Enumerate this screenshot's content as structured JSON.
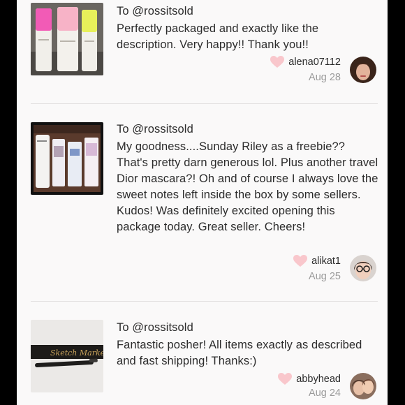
{
  "reviews": [
    {
      "recipient": "To @rossitsold",
      "body": "Perfectly packaged and exactly like the description. Very happy!! Thank you!!",
      "username": "alena07112",
      "date": "Aug 28",
      "thumbnail": "three-sunday-riley-bottles-photo",
      "avatar": "user-avatar-photo"
    },
    {
      "recipient": "To @rossitsold",
      "body": "My goodness....Sunday Riley as a freebie?? That's pretty darn generous lol. Plus another travel Dior mascara?! Oh and of course I always love the sweet notes left inside the box by some sellers. Kudos! Was definitely excited opening this package today. Great seller. Cheers!",
      "username": "alikat1",
      "date": "Aug 25",
      "thumbnail": "skincare-tubes-photo",
      "avatar": "user-avatar-photo"
    },
    {
      "recipient": "To @rossitsold",
      "body": "Fantastic posher! All items exactly as described and fast shipping! Thanks:)",
      "username": "abbyhead",
      "date": "Aug 24",
      "thumbnail": "sketch-marker-eyeliner-photo",
      "thumbnail_label": "Sketch Marker",
      "avatar": "user-avatar-photo"
    }
  ],
  "colors": {
    "heart": "#f9c7cc",
    "date": "#9b9b9b",
    "text": "#2b2b2b",
    "background": "#faf9f9"
  }
}
